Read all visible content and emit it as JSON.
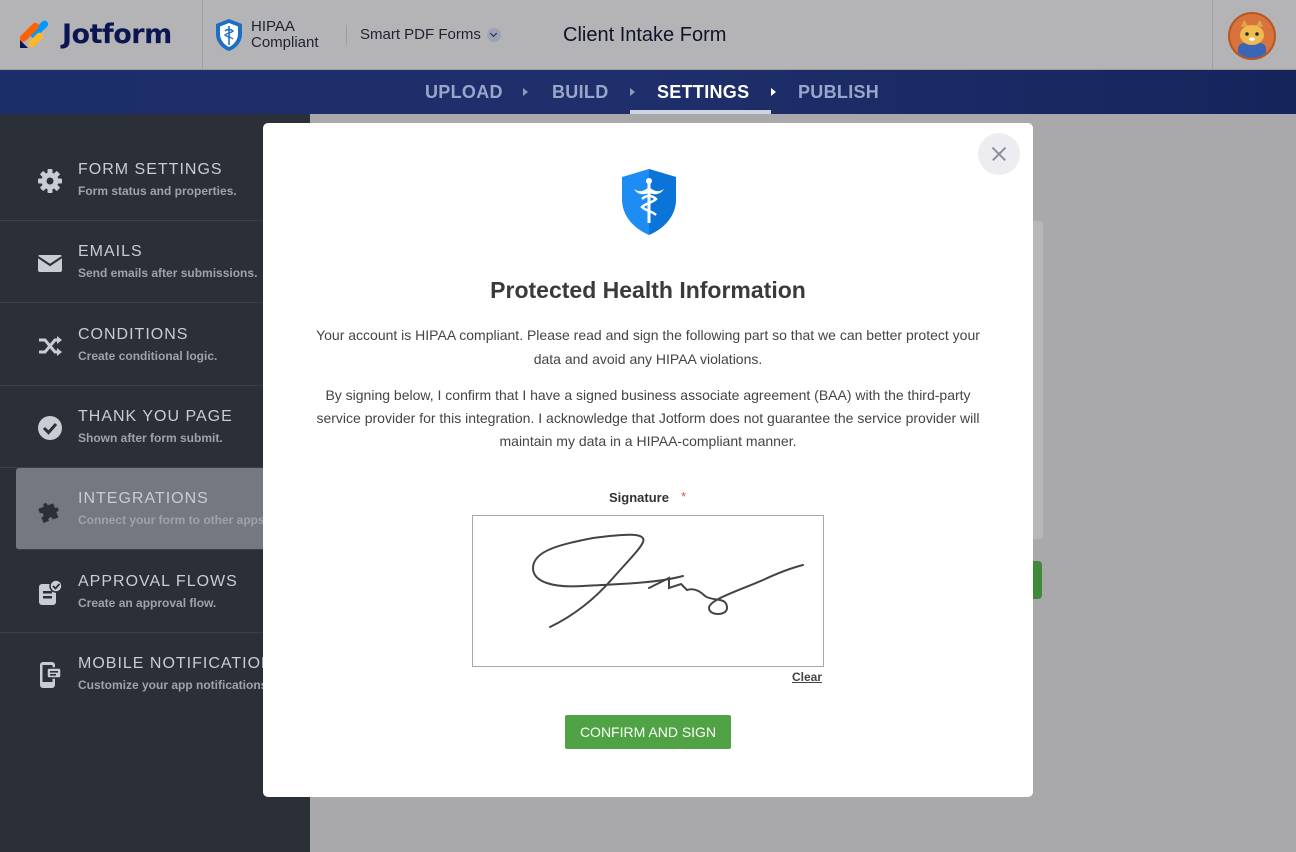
{
  "header": {
    "brand": "Jotform",
    "hipaa_line1": "HIPAA",
    "hipaa_line2": "Compliant",
    "product": "Smart PDF Forms",
    "form_title": "Client Intake Form"
  },
  "nav": {
    "items": [
      {
        "label": "UPLOAD"
      },
      {
        "label": "BUILD"
      },
      {
        "label": "SETTINGS",
        "active": true
      },
      {
        "label": "PUBLISH"
      }
    ]
  },
  "sidebar": {
    "items": [
      {
        "title": "FORM SETTINGS",
        "sub": "Form status and properties.",
        "icon": "gear-icon"
      },
      {
        "title": "EMAILS",
        "sub": "Send emails after submissions.",
        "icon": "envelope-icon"
      },
      {
        "title": "CONDITIONS",
        "sub": "Create conditional logic.",
        "icon": "shuffle-icon"
      },
      {
        "title": "THANK YOU PAGE",
        "sub": "Shown after form submit.",
        "icon": "check-circle-icon"
      },
      {
        "title": "INTEGRATIONS",
        "sub": "Connect your form to other apps.",
        "icon": "puzzle-icon",
        "active": true
      },
      {
        "title": "APPROVAL FLOWS",
        "sub": "Create an approval flow.",
        "icon": "approval-icon"
      },
      {
        "title": "MOBILE NOTIFICATIONS",
        "sub": "Customize your app notifications.",
        "icon": "mobile-icon"
      }
    ]
  },
  "modal": {
    "title": "Protected Health Information",
    "paragraph1": "Your account is HIPAA compliant. Please read and sign the following part so that we can better protect your data and avoid any HIPAA violations.",
    "paragraph2": "By signing below, I confirm that I have a signed business associate agreement (BAA) with the third-party service provider for this integration. I acknowledge that Jotform does not guarantee the service provider will maintain my data in a HIPAA-compliant manner.",
    "signature_label": "Signature",
    "required_mark": "*",
    "clear_label": "Clear",
    "confirm_label": "CONFIRM AND SIGN"
  },
  "colors": {
    "brand_navy": "#0a1551",
    "nav_bg": "#1f2f6b",
    "sidebar_bg": "#2a2f38",
    "confirm_green": "#4fa344",
    "shield_blue": "#1d8df3"
  }
}
